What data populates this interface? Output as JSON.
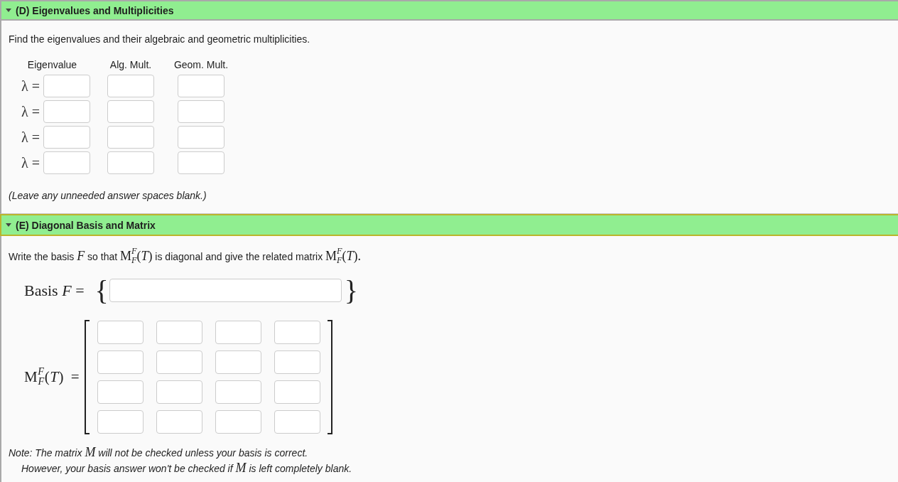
{
  "sections": [
    {
      "kind": "eigenvalues",
      "title": "(D) Eigenvalues and Multiplicities",
      "expanded": true,
      "focused": false,
      "prompt": [
        {
          "kind": "text",
          "text": "Find the eigenvalues and their algebraic and geometric multiplicities."
        }
      ],
      "table": {
        "columns": [
          "Eigenvalue",
          "Alg. Mult.",
          "Geom. Mult."
        ],
        "rows": [
          {
            "label": "λ ="
          },
          {
            "label": "λ ="
          },
          {
            "label": "λ ="
          },
          {
            "label": "λ ="
          }
        ]
      },
      "notes": [
        {
          "indented": false,
          "segments": [
            {
              "kind": "text",
              "text": "(Leave any unneeded answer spaces blank.)"
            }
          ]
        }
      ]
    },
    {
      "kind": "diagonalization",
      "title": "(E) Diagonal Basis and Matrix",
      "expanded": true,
      "focused": true,
      "prompt": [
        {
          "kind": "text",
          "text": "Write the basis"
        },
        {
          "kind": "math",
          "text": "*F*"
        },
        {
          "kind": "text",
          "text": "so that"
        },
        {
          "kind": "math",
          "text": "M$^{F}$$_{F}$(*T*)"
        },
        {
          "kind": "text",
          "text": "is diagonal and give the related matrix"
        },
        {
          "kind": "math",
          "text": "M$^{F}$$_{F}$(*T*)."
        }
      ],
      "basis": {
        "label": "Basis *F* =",
        "open": "{",
        "close": "}"
      },
      "matrix": {
        "label": "M$^{F}$$_{F}$(*T*) =",
        "rows": [
          {
            "cells": [
              {
                "kind": "blank"
              },
              {
                "kind": "blank"
              },
              {
                "kind": "blank"
              },
              {
                "kind": "blank"
              }
            ]
          },
          {
            "cells": [
              {
                "kind": "blank"
              },
              {
                "kind": "blank"
              },
              {
                "kind": "blank"
              },
              {
                "kind": "blank"
              }
            ]
          },
          {
            "cells": [
              {
                "kind": "blank"
              },
              {
                "kind": "blank"
              },
              {
                "kind": "blank"
              },
              {
                "kind": "blank"
              }
            ]
          },
          {
            "cells": [
              {
                "kind": "blank"
              },
              {
                "kind": "blank"
              },
              {
                "kind": "blank"
              },
              {
                "kind": "blank"
              }
            ]
          }
        ]
      },
      "notes": [
        {
          "indented": false,
          "segments": [
            {
              "kind": "text",
              "text": "Note: The matrix"
            },
            {
              "kind": "math",
              "text": "*M*"
            },
            {
              "kind": "text",
              "text": "will not be checked unless your basis is correct."
            }
          ]
        },
        {
          "indented": true,
          "segments": [
            {
              "kind": "text",
              "text": "However, your basis answer won't be checked if"
            },
            {
              "kind": "math",
              "text": "*M*"
            },
            {
              "kind": "text",
              "text": "is left completely blank."
            }
          ]
        }
      ]
    }
  ]
}
